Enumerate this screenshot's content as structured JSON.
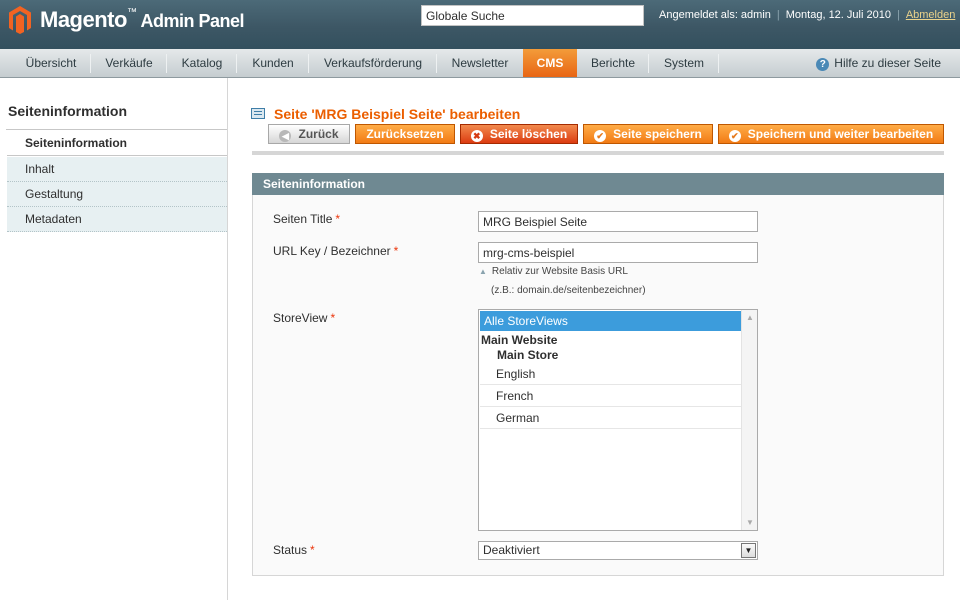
{
  "header": {
    "brand": "Magento",
    "brand_suffix": "Admin Panel",
    "search_value": "Globale Suche",
    "logged_in": "Angemeldet als: admin",
    "date": "Montag, 12. Juli 2010",
    "logout": "Abmelden"
  },
  "nav": {
    "items": [
      "Übersicht",
      "Verkäufe",
      "Katalog",
      "Kunden",
      "Verkaufsförderung",
      "Newsletter",
      "CMS",
      "Berichte",
      "System"
    ],
    "active": "CMS",
    "help": "Hilfe zu dieser Seite"
  },
  "sidebar": {
    "title": "Seiteninformation",
    "items": [
      "Seiteninformation",
      "Inhalt",
      "Gestaltung",
      "Metadaten"
    ],
    "active": "Seiteninformation"
  },
  "page": {
    "title": "Seite 'MRG Beispiel Seite' bearbeiten",
    "buttons": {
      "back": "Zurück",
      "reset": "Zurücksetzen",
      "delete": "Seite löschen",
      "save": "Seite speichern",
      "save_continue": "Speichern und weiter bearbeiten"
    }
  },
  "form": {
    "section_title": "Seiteninformation",
    "page_title_label": "Seiten Title",
    "page_title_value": "MRG Beispiel Seite",
    "url_key_label": "URL Key / Bezeichner",
    "url_key_value": "mrg-cms-beispiel",
    "url_note_1": "Relativ zur Website Basis URL",
    "url_note_2": "(z.B.: domain.de/seitenbezeichner)",
    "storeview_label": "StoreView",
    "storeview_options": {
      "all": "Alle StoreViews",
      "website": "Main Website",
      "store": "Main Store",
      "views": [
        "English",
        "French",
        "German"
      ]
    },
    "status_label": "Status",
    "status_value": "Deaktiviert",
    "required_mark": "*"
  },
  "colors": {
    "header_bg": "#3d5765",
    "accent_orange": "#eb5e00",
    "cms_tab": "#e86514",
    "section_head": "#6f8992",
    "selection": "#3c9cdc"
  }
}
